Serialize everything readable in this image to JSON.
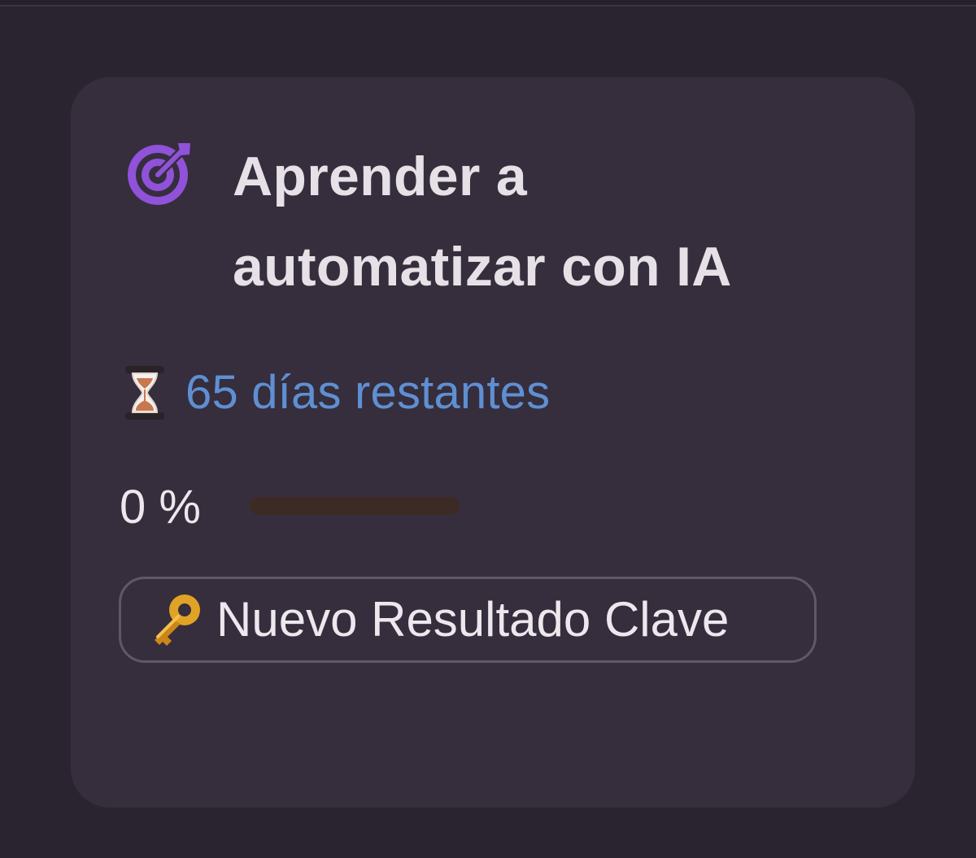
{
  "goal": {
    "title": "Aprender a automatizar con IA",
    "icon": "target-icon",
    "accent_color": "#8f52d9"
  },
  "deadline": {
    "icon": "hourglass-icon",
    "text": "65 días restantes",
    "color": "#5f8fd3"
  },
  "progress": {
    "label": "0 %",
    "value": 0
  },
  "actions": {
    "new_key_result_icon": "key-icon",
    "new_key_result_label": "Nuevo Resultado Clave"
  }
}
